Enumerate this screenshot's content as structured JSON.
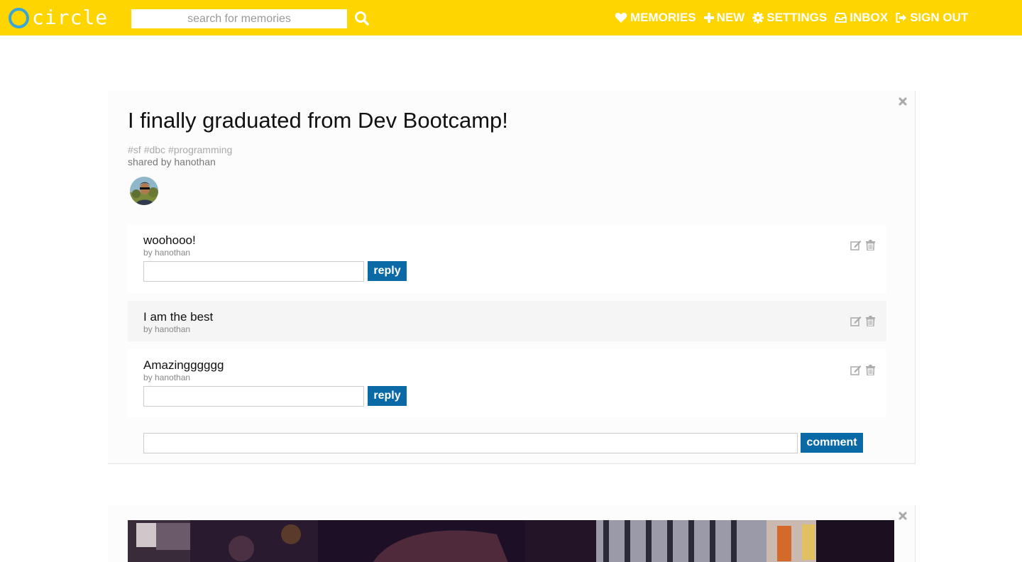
{
  "app": {
    "brand": "circle",
    "colors": {
      "topbar": "#ffd500",
      "accent": "#3aa6d6",
      "button": "#0b6aa5"
    }
  },
  "header": {
    "search_placeholder": "search for memories",
    "search_value": "",
    "nav": [
      {
        "label": "MEMORIES",
        "icon": "heart-icon"
      },
      {
        "label": "NEW",
        "icon": "plus-icon"
      },
      {
        "label": "SETTINGS",
        "icon": "gear-icon"
      },
      {
        "label": "INBOX",
        "icon": "inbox-icon"
      },
      {
        "label": "SIGN OUT",
        "icon": "sign-out-icon"
      }
    ]
  },
  "post": {
    "title": "I finally graduated from Dev Bootcamp!",
    "tags": [
      "#sf",
      "#dbc",
      "#programming"
    ],
    "shared_by": "shared by hanothan",
    "comments": [
      {
        "text": "woohooo!",
        "by": "by hanothan",
        "has_reply": true,
        "reply_value": "",
        "reply_label": "reply"
      },
      {
        "text": "I am the best",
        "by": "by hanothan",
        "has_reply": false
      },
      {
        "text": "Amazingggggg",
        "by": "by hanothan",
        "has_reply": true,
        "reply_value": "",
        "reply_label": "reply"
      }
    ],
    "comment_value": "",
    "comment_label": "comment"
  }
}
